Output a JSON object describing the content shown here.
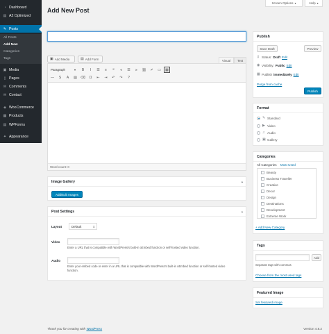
{
  "sidebar": {
    "items": [
      {
        "label": "Dashboard",
        "icon": "dashboard-icon",
        "glyph": "◔"
      },
      {
        "label": "A2 Optimized",
        "icon": "a2-optimized-icon",
        "glyph": "▤"
      },
      {
        "label": "Posts",
        "icon": "pin-icon",
        "glyph": "✎"
      },
      {
        "label": "Media",
        "icon": "media-icon",
        "glyph": "▣"
      },
      {
        "label": "Pages",
        "icon": "pages-icon",
        "glyph": "▯"
      },
      {
        "label": "Comments",
        "icon": "comments-icon",
        "glyph": "✉"
      },
      {
        "label": "Contact",
        "icon": "contact-icon",
        "glyph": "✉"
      },
      {
        "label": "WooCommerce",
        "icon": "woocommerce-icon",
        "glyph": "◈"
      },
      {
        "label": "Products",
        "icon": "products-icon",
        "glyph": "▦"
      },
      {
        "label": "WPForms",
        "icon": "wpforms-icon",
        "glyph": "▤"
      },
      {
        "label": "Appearance",
        "icon": "appearance-icon",
        "glyph": "✦"
      }
    ],
    "submenu": [
      "All Posts",
      "Add New",
      "Categories",
      "Tags"
    ]
  },
  "header": {
    "screen_options": "Screen Options",
    "help": "Help",
    "page_title": "Add New Post"
  },
  "editor": {
    "add_media": "Add Media",
    "add_form": "Add Form",
    "tab_visual": "Visual",
    "tab_text": "Text",
    "format": "Paragraph",
    "word_count": "Word count: 0",
    "toolbar_row1": [
      {
        "name": "bold-icon",
        "g": "B"
      },
      {
        "name": "italic-icon",
        "g": "I"
      },
      {
        "name": "bullet-list-icon",
        "g": "☰"
      },
      {
        "name": "numbered-list-icon",
        "g": "≡"
      },
      {
        "name": "blockquote-icon",
        "g": "❝"
      },
      {
        "name": "align-left-icon",
        "g": "⫷"
      },
      {
        "name": "align-center-icon",
        "g": "☰"
      },
      {
        "name": "align-right-icon",
        "g": "⫸"
      },
      {
        "name": "link-icon",
        "g": "⛓"
      },
      {
        "name": "unlink-icon",
        "g": "⌿"
      },
      {
        "name": "read-more-icon",
        "g": "▭"
      },
      {
        "name": "toolbar-toggle-icon",
        "g": "▦"
      }
    ],
    "toolbar_row2": [
      {
        "name": "horizontal-line-icon",
        "g": "—"
      },
      {
        "name": "strikethrough-icon",
        "g": "S"
      },
      {
        "name": "text-color-icon",
        "g": "A"
      },
      {
        "name": "paste-text-icon",
        "g": "▤"
      },
      {
        "name": "clear-formatting-icon",
        "g": "⌫"
      },
      {
        "name": "special-character-icon",
        "g": "Ω"
      },
      {
        "name": "outdent-icon",
        "g": "⇤"
      },
      {
        "name": "indent-icon",
        "g": "⇥"
      },
      {
        "name": "undo-icon",
        "g": "↶"
      },
      {
        "name": "redo-icon",
        "g": "↷"
      },
      {
        "name": "keyboard-shortcuts-icon",
        "g": "?"
      }
    ]
  },
  "image_gallery": {
    "title": "Image Gallery",
    "button": "Add/Edit Images"
  },
  "post_settings": {
    "title": "Post Settings",
    "layout_label": "Layout",
    "layout_value": "Default",
    "video_label": "Video",
    "video_help": "Enter a URL that is compatible with WordPress's built-in oEmbed function or self-hosted video function.",
    "audio_label": "Audio",
    "audio_help": "Enter your embed code or enter in a URL that is compatible with WordPress's built-in oEmbed function or self-hosted video function."
  },
  "publish": {
    "title": "Publish",
    "save_draft": "Save Draft",
    "preview": "Preview",
    "status_label": "Status:",
    "status_value": "Draft",
    "visibility_label": "Visibility:",
    "visibility_value": "Public",
    "publish_label": "Publish",
    "publish_value": "immediately",
    "edit": "Edit",
    "purge": "Purge from cache",
    "publish_button": "Publish"
  },
  "format": {
    "title": "Format",
    "options": [
      "Standard",
      "Video",
      "Audio",
      "Gallery"
    ],
    "selected": 0
  },
  "categories": {
    "title": "Categories",
    "tab_all": "All Categories",
    "tab_used": "Most Used",
    "items": [
      "Beauty",
      "Business Traveller",
      "Creative",
      "Decor",
      "Design",
      "Destinations",
      "Development",
      "Extreme Work"
    ],
    "add_new": "+ Add New Category"
  },
  "tags": {
    "title": "Tags",
    "add": "Add",
    "help": "Separate tags with commas",
    "choose": "Choose from the most used tags"
  },
  "featured_image": {
    "title": "Featured Image",
    "link": "Set featured image"
  },
  "footer": {
    "thanks": "Thank you for creating with",
    "wordpress": "WordPress",
    "version": "Version 4.8.2"
  }
}
